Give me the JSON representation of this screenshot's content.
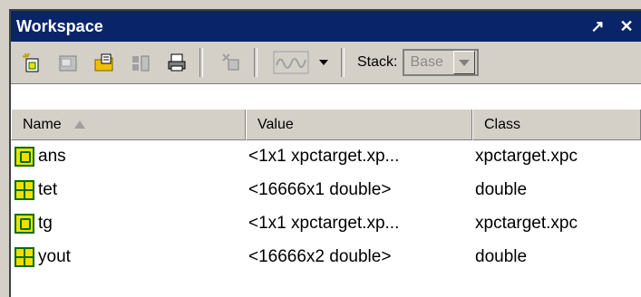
{
  "window": {
    "title": "Workspace",
    "undock_glyph": "↗",
    "close_glyph": "✕"
  },
  "toolbar": {
    "icons": [
      "new-variable-icon",
      "open-variable-icon",
      "import-data-icon",
      "save-icon",
      "print-icon",
      "delete-icon",
      "plot-icon"
    ],
    "stack_label": "Stack:",
    "stack_value": "Base"
  },
  "columns": [
    {
      "label": "Name"
    },
    {
      "label": "Value"
    },
    {
      "label": "Class"
    }
  ],
  "rows": [
    {
      "icon": "object-icon",
      "name": "ans",
      "value": "<1x1 xpctarget.xp...",
      "class": "xpctarget.xpc"
    },
    {
      "icon": "matrix-icon",
      "name": "tet",
      "value": "<16666x1 double>",
      "class": "double"
    },
    {
      "icon": "object-icon",
      "name": "tg",
      "value": "<1x1 xpctarget.xp...",
      "class": "xpctarget.xpc"
    },
    {
      "icon": "matrix-icon",
      "name": "yout",
      "value": "<16666x2 double>",
      "class": "double"
    }
  ],
  "colors": {
    "titlebar": "#0a246a",
    "chrome": "#d4d0c8",
    "icon_fill": "#f0e000",
    "icon_stroke": "#007000"
  }
}
